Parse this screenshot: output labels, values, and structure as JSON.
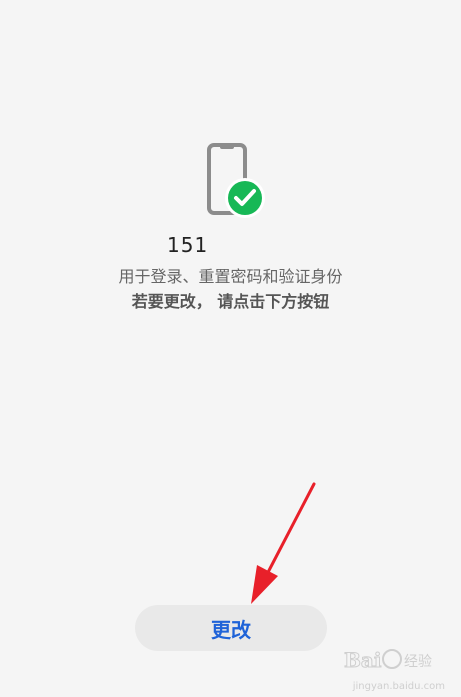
{
  "phone_number": "151",
  "description": "用于登录、重置密码和验证身份",
  "hint": "若要更改， 请点击下方按钮",
  "change_button_label": "更改",
  "watermark": {
    "brand": "Baidu 经验",
    "url": "jingyan.baidu.com"
  },
  "colors": {
    "background": "#f5f5f5",
    "button_text": "#1f63d8",
    "check_green": "#17b856",
    "arrow_red": "#e8202a"
  },
  "icons": {
    "phone_verified": "phone-with-check-icon"
  }
}
